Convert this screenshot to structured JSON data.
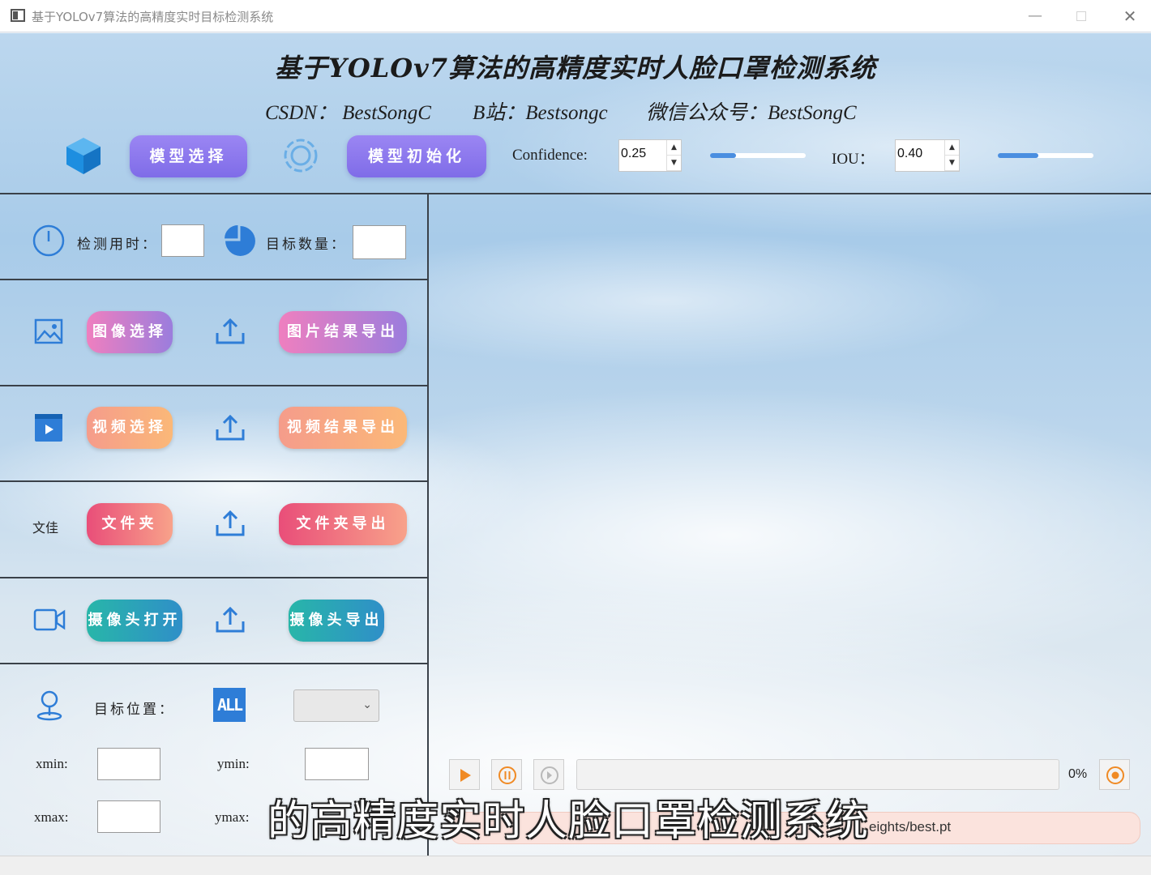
{
  "window": {
    "title": "基于YOLOv7算法的高精度实时目标检测系统",
    "min_glyph": "—",
    "close_glyph": "✕"
  },
  "header": {
    "title": "基于YOLOv7算法的高精度实时人脸口罩检测系统",
    "credits": [
      "CSDN：  BestSongC",
      "B站：Bestsongc",
      "微信公众号：BestSongC"
    ]
  },
  "toolbar": {
    "model_select_label": "模型选择",
    "model_init_label": "模型初始化",
    "confidence_label": "Confidence:",
    "confidence_value": "0.25",
    "confidence_slider_fraction": 0.27,
    "iou_label": "IOU：",
    "iou_value": "0.40",
    "iou_slider_fraction": 0.42,
    "spin_up": "▲",
    "spin_down": "▼"
  },
  "stats": {
    "time_label": "检测用时：",
    "time_value": "",
    "count_label": "目标数量：",
    "count_value": ""
  },
  "actions": {
    "image_select": "图像选择",
    "image_export": "图片结果导出",
    "video_select": "视频选择",
    "video_export": "视频结果导出",
    "folder_icon_text": "文佳",
    "folder_select": "文件夹",
    "folder_export": "文件夹导出",
    "camera_open": "摄像头打开",
    "camera_export": "摄像头导出"
  },
  "position": {
    "label": "目标位置：",
    "all_icon_text": "ALL",
    "dropdown_value": "",
    "dropdown_arrow": "⌄",
    "xmin_label": "xmin:",
    "ymin_label": "ymin:",
    "xmax_label": "xmax:",
    "ymax_label": "ymax:",
    "xmin": "",
    "ymin": "",
    "xmax": "",
    "ymax": ""
  },
  "playback": {
    "progress_percent": 0,
    "progress_text": "0%"
  },
  "status": {
    "text": "eights/best.pt"
  },
  "caption": {
    "text": "的高精度实时人脸口罩检测系统"
  },
  "colors": {
    "accent_blue": "#2e7dd7",
    "purple": "#8a76ee",
    "status_bg": "#fbe3dd"
  }
}
